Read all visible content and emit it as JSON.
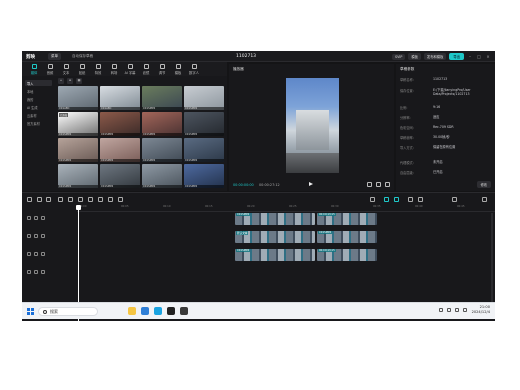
{
  "titlebar": {
    "logo": "剪映",
    "menu_label": "菜单",
    "file_label": "自动保存草稿",
    "project_title": "1102713",
    "chip_pro": "SVIP",
    "chip_flag": "模板",
    "chip_share": "发布和模板",
    "export_label": "导出"
  },
  "toolbar": {
    "items": [
      {
        "label": "媒体"
      },
      {
        "label": "音频"
      },
      {
        "label": "文本"
      },
      {
        "label": "贴纸"
      },
      {
        "label": "特效"
      },
      {
        "label": "转场"
      },
      {
        "label": "AI 字幕"
      },
      {
        "label": "滤镜"
      },
      {
        "label": "调节"
      },
      {
        "label": "模板"
      },
      {
        "label": "数字人"
      }
    ]
  },
  "sidebar": {
    "items": [
      {
        "label": "导入"
      },
      {
        "label": "本地"
      },
      {
        "label": "我的"
      },
      {
        "label": "AI 生成"
      },
      {
        "label": "云素材"
      },
      {
        "label": "官方素材"
      }
    ]
  },
  "media": {
    "thumbs": [
      {
        "cap": "C01ABC"
      },
      {
        "cap": "C01ABC"
      },
      {
        "cap": "C01SMP4"
      },
      {
        "cap": "C01SMP4"
      },
      {
        "cap": "C01SMP4",
        "tag": "已添加"
      },
      {
        "cap": "C01SMP4"
      },
      {
        "cap": "C01SMP4"
      },
      {
        "cap": "C01SMP4"
      },
      {
        "cap": "C01SMP4"
      },
      {
        "cap": "C01SMP4"
      },
      {
        "cap": "C01SMP4"
      },
      {
        "cap": "C01SMP4"
      },
      {
        "cap": "C01SMP4"
      },
      {
        "cap": "C01SMP4"
      },
      {
        "cap": "C01SMP4"
      },
      {
        "cap": "C01SMP4"
      }
    ]
  },
  "player": {
    "title": "播放器",
    "current_time": "00:00:00:00",
    "duration": "00:00:27:12"
  },
  "details": {
    "title": "草稿参数",
    "rows": [
      {
        "key": "草稿名称:",
        "val": "1102713"
      },
      {
        "key": "保存位置:",
        "val": "E:/下载/JianyingPro/User Data/Projects/1102713"
      },
      {
        "key": "比例:",
        "val": "9:16"
      },
      {
        "key": "分辨率:",
        "val": "适应"
      },
      {
        "key": "色彩空间:",
        "val": "Rec.709 SDR"
      },
      {
        "key": "草稿帧率:",
        "val": "30.00帧/秒"
      },
      {
        "key": "导入方式:",
        "val": "保留在原有位置"
      },
      {
        "key": "代理模式:",
        "val": "未开启"
      },
      {
        "key": "自由层级:",
        "val": "已开启"
      }
    ],
    "edit_label": "修改"
  },
  "timeline": {
    "ruler": [
      "00:00",
      "00:05",
      "00:10",
      "00:15",
      "00:20",
      "00:25",
      "00:30",
      "00:35",
      "00:40",
      "00:45"
    ],
    "track_label": "封面",
    "clip_label": "C01SMP4",
    "clip_label_2": "00:00:13:15",
    "text_label": "默认文本"
  },
  "taskbar": {
    "search_placeholder": "搜索",
    "time": "21:00",
    "date": "2024/12/4"
  }
}
